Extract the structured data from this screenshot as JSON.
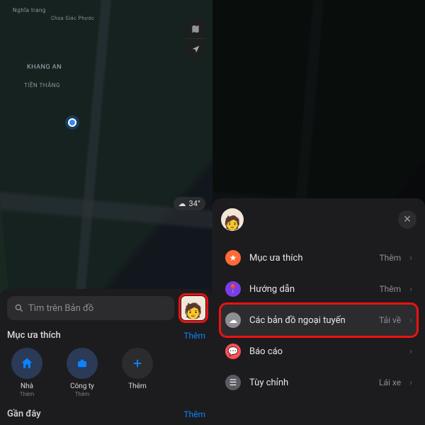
{
  "left": {
    "map_labels": {
      "khang_an": "KHANG AN",
      "tien_thang": "TIỀN THẮNG",
      "nghia_trang": "Nghĩa trang",
      "chua": "Chùa Giác Phước"
    },
    "weather_temp": "34°",
    "search_placeholder": "Tìm trên Bản đồ",
    "favorites_title": "Mục ưa thích",
    "favorites_more": "Thêm",
    "favorites": [
      {
        "label": "Nhà",
        "sub": "Thêm",
        "icon": "home"
      },
      {
        "label": "Công ty",
        "sub": "Thêm",
        "icon": "briefcase"
      },
      {
        "label": "Thêm",
        "sub": "",
        "icon": "plus"
      }
    ],
    "recent_title": "Gần đây",
    "recent_more": "Thêm"
  },
  "right": {
    "menu": [
      {
        "icon": "star",
        "label": "Mục ưa thích",
        "action": "Thêm"
      },
      {
        "icon": "guide",
        "label": "Hướng dẫn",
        "action": "Thêm"
      },
      {
        "icon": "cloud",
        "label": "Các bản đồ ngoại tuyến",
        "action": "Tải về",
        "highlight": true
      },
      {
        "icon": "report",
        "label": "Báo cáo",
        "action": ""
      },
      {
        "icon": "custom",
        "label": "Tùy chỉnh",
        "action": "Lái xe"
      }
    ]
  }
}
